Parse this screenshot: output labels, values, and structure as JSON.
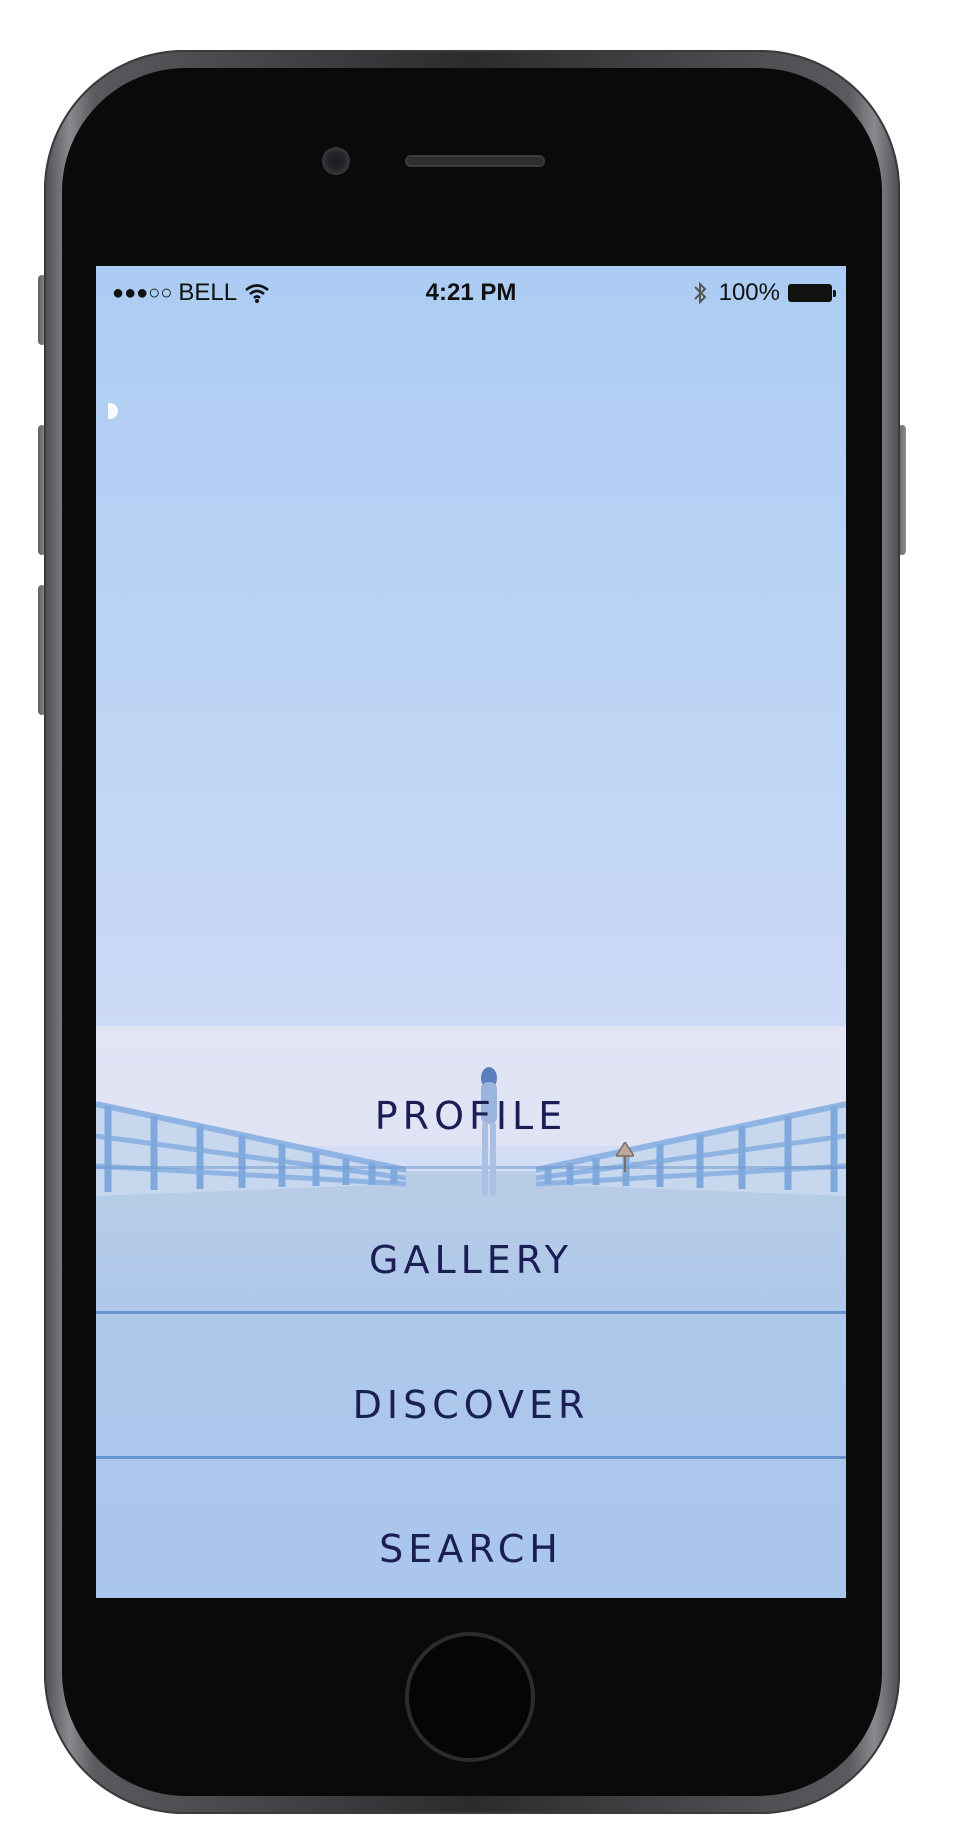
{
  "status_bar": {
    "signal": "●●●○○",
    "carrier": "BELL",
    "time": "4:21 PM",
    "battery": "100%"
  },
  "menu": {
    "items": [
      {
        "label": "PROFILE"
      },
      {
        "label": "GALLERY"
      },
      {
        "label": "DISCOVER"
      },
      {
        "label": "SEARCH"
      }
    ]
  },
  "colors": {
    "menu_text": "#1b1d55",
    "divider": "#5d8cc9",
    "sky_top": "#acccf3",
    "phone_body": "#0a0a0a"
  },
  "icons": [
    "wifi-icon",
    "bluetooth-icon",
    "battery-icon"
  ]
}
